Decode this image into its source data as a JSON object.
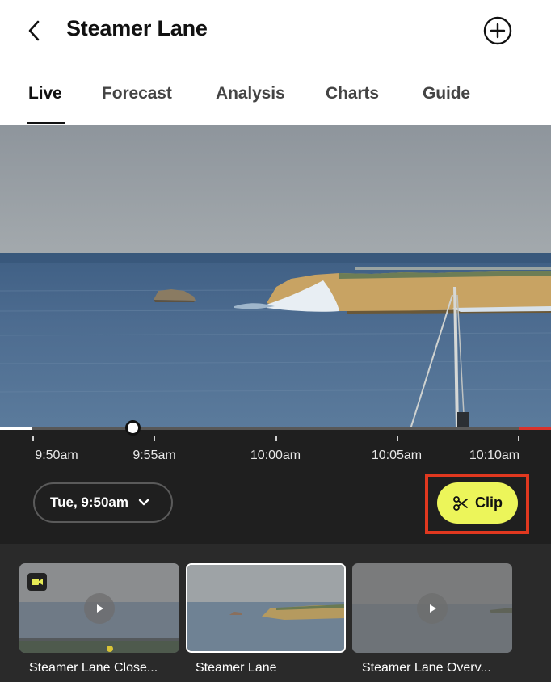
{
  "header": {
    "title": "Steamer Lane",
    "back_icon": "chevron-left-icon",
    "add_icon": "plus-circle-icon"
  },
  "tabs": [
    {
      "label": "Live",
      "active": true
    },
    {
      "label": "Forecast",
      "active": false
    },
    {
      "label": "Analysis",
      "active": false
    },
    {
      "label": "Charts",
      "active": false
    },
    {
      "label": "Guide",
      "active": false
    }
  ],
  "timeline": {
    "ticks": [
      "9:50am",
      "9:55am",
      "10:00am",
      "10:05am",
      "10:10am"
    ],
    "selected_time": "Tue, 9:50am",
    "clip_label": "Clip",
    "colors": {
      "accent": "#ecf55a",
      "live_edge": "#d9322b",
      "highlight": "#e0381f"
    }
  },
  "cameras": [
    {
      "label": "Steamer Lane Close...",
      "selected": false,
      "badge_icon": "video-camera-icon"
    },
    {
      "label": "Steamer Lane",
      "selected": true
    },
    {
      "label": "Steamer Lane Overv...",
      "selected": false
    }
  ]
}
